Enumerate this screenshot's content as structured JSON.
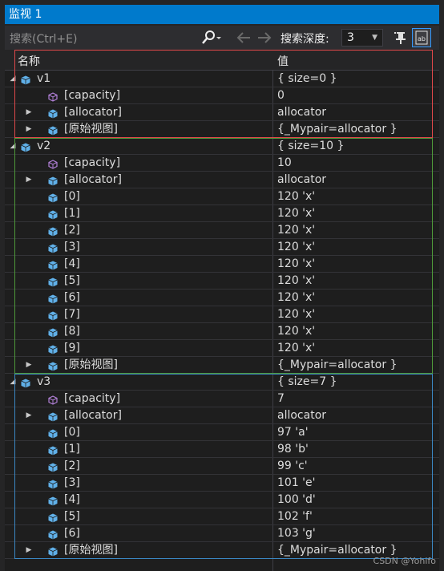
{
  "window": {
    "title": "监视 1"
  },
  "toolbar": {
    "search_placeholder": "搜索(Ctrl+E)",
    "depth_label": "搜索深度:",
    "depth_value": "3"
  },
  "grid": {
    "col_name": "名称",
    "col_value": "值",
    "rows": [
      {
        "level": 0,
        "expander": "open",
        "icon": "field",
        "name": "v1",
        "value": "{ size=0 }"
      },
      {
        "level": 1,
        "expander": "none",
        "icon": "property",
        "name": "[capacity]",
        "value": "0"
      },
      {
        "level": 1,
        "expander": "closed",
        "icon": "field",
        "name": "[allocator]",
        "value": "allocator"
      },
      {
        "level": 1,
        "expander": "closed",
        "icon": "field",
        "name": "[原始视图]",
        "value": "{_Mypair=allocator }"
      },
      {
        "level": 0,
        "expander": "open",
        "icon": "field",
        "name": "v2",
        "value": "{ size=10 }"
      },
      {
        "level": 1,
        "expander": "none",
        "icon": "property",
        "name": "[capacity]",
        "value": "10"
      },
      {
        "level": 1,
        "expander": "closed",
        "icon": "field",
        "name": "[allocator]",
        "value": "allocator"
      },
      {
        "level": 1,
        "expander": "none",
        "icon": "field",
        "name": "[0]",
        "value": "120 'x'"
      },
      {
        "level": 1,
        "expander": "none",
        "icon": "field",
        "name": "[1]",
        "value": "120 'x'"
      },
      {
        "level": 1,
        "expander": "none",
        "icon": "field",
        "name": "[2]",
        "value": "120 'x'"
      },
      {
        "level": 1,
        "expander": "none",
        "icon": "field",
        "name": "[3]",
        "value": "120 'x'"
      },
      {
        "level": 1,
        "expander": "none",
        "icon": "field",
        "name": "[4]",
        "value": "120 'x'"
      },
      {
        "level": 1,
        "expander": "none",
        "icon": "field",
        "name": "[5]",
        "value": "120 'x'"
      },
      {
        "level": 1,
        "expander": "none",
        "icon": "field",
        "name": "[6]",
        "value": "120 'x'"
      },
      {
        "level": 1,
        "expander": "none",
        "icon": "field",
        "name": "[7]",
        "value": "120 'x'"
      },
      {
        "level": 1,
        "expander": "none",
        "icon": "field",
        "name": "[8]",
        "value": "120 'x'"
      },
      {
        "level": 1,
        "expander": "none",
        "icon": "field",
        "name": "[9]",
        "value": "120 'x'"
      },
      {
        "level": 1,
        "expander": "closed",
        "icon": "field",
        "name": "[原始视图]",
        "value": "{_Mypair=allocator }"
      },
      {
        "level": 0,
        "expander": "open",
        "icon": "field",
        "name": "v3",
        "value": "{ size=7 }"
      },
      {
        "level": 1,
        "expander": "none",
        "icon": "property",
        "name": "[capacity]",
        "value": "7"
      },
      {
        "level": 1,
        "expander": "closed",
        "icon": "field",
        "name": "[allocator]",
        "value": "allocator"
      },
      {
        "level": 1,
        "expander": "none",
        "icon": "field",
        "name": "[0]",
        "value": "97 'a'"
      },
      {
        "level": 1,
        "expander": "none",
        "icon": "field",
        "name": "[1]",
        "value": "98 'b'"
      },
      {
        "level": 1,
        "expander": "none",
        "icon": "field",
        "name": "[2]",
        "value": "99 'c'"
      },
      {
        "level": 1,
        "expander": "none",
        "icon": "field",
        "name": "[3]",
        "value": "101 'e'"
      },
      {
        "level": 1,
        "expander": "none",
        "icon": "field",
        "name": "[4]",
        "value": "100 'd'"
      },
      {
        "level": 1,
        "expander": "none",
        "icon": "field",
        "name": "[5]",
        "value": "102 'f'"
      },
      {
        "level": 1,
        "expander": "none",
        "icon": "field",
        "name": "[6]",
        "value": "103 'g'"
      },
      {
        "level": 1,
        "expander": "closed",
        "icon": "field",
        "name": "[原始视图]",
        "value": "{_Mypair=allocator }"
      }
    ]
  },
  "highlight_colors": {
    "v1": "#e0484a",
    "v2": "#4e9a3a",
    "v3": "#3b88c4"
  },
  "colors": {
    "field_icon": "#60b0e8",
    "property_icon": "#b180d7",
    "accent": "#007acc"
  },
  "watermark": "CSDN @Yohifo"
}
